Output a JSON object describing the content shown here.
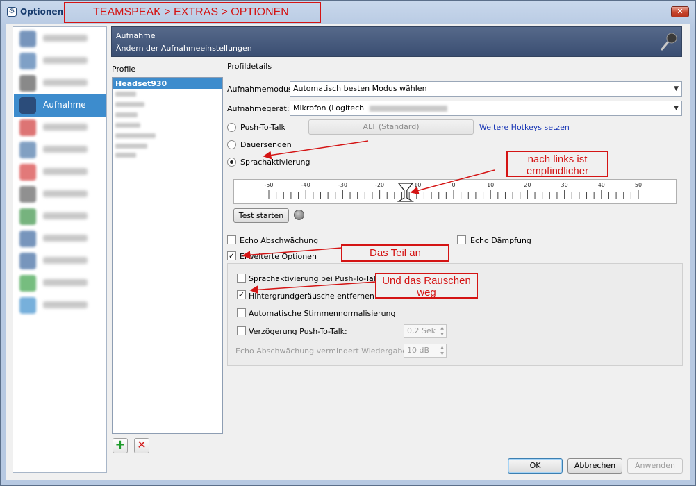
{
  "window": {
    "title": "Optionen",
    "close_symbol": "✕"
  },
  "annotation_title": "TEAMSPEAK > EXTRAS > OPTIONEN",
  "sidebar": {
    "active_label": "Aufnahme",
    "items": [
      {
        "icon": "blurred-icon",
        "color": "#2f5d99"
      },
      {
        "icon": "blurred-icon",
        "color": "#3c6ea8"
      },
      {
        "icon": "blurred-icon",
        "color": "#4b4b4b"
      },
      {
        "icon": "microphone-icon",
        "color": "#2b4c7a"
      },
      {
        "icon": "blurred-icon",
        "color": "#cc2a2a"
      },
      {
        "icon": "blurred-icon",
        "color": "#3f6ea3"
      },
      {
        "icon": "blurred-icon",
        "color": "#d43232"
      },
      {
        "icon": "blurred-icon",
        "color": "#555555"
      },
      {
        "icon": "blurred-icon",
        "color": "#2e8c3a"
      },
      {
        "icon": "blurred-icon",
        "color": "#2f5d99"
      },
      {
        "icon": "blurred-icon",
        "color": "#2f5d99"
      },
      {
        "icon": "blurred-icon",
        "color": "#2e9a3c"
      },
      {
        "icon": "blurred-icon",
        "color": "#2f86c8"
      }
    ]
  },
  "banner": {
    "title": "Aufnahme",
    "subtitle": "Ändern der Aufnahmeeinstellungen"
  },
  "profiles": {
    "heading": "Profile",
    "selected": "Headset930",
    "add_symbol": "+",
    "remove_symbol": "✕"
  },
  "details": {
    "heading": "Profildetails",
    "mode_label": "Aufnahmemodus:",
    "mode_value": "Automatisch besten Modus wählen",
    "device_label": "Aufnahmegerät:",
    "device_value": "Mikrofon (Logitech",
    "combo_arrow": "▼",
    "ptt_label": "Push-To-Talk",
    "hotkey_button": "ALT (Standard)",
    "hotkeys_link": "Weitere Hotkeys setzen",
    "continuous_label": "Dauersenden",
    "voice_activation_label": "Sprachaktivierung",
    "slider_ticks": [
      "-50",
      "-40",
      "-30",
      "-20",
      "-10",
      "0",
      "10",
      "20",
      "30",
      "40",
      "50"
    ],
    "slider_value": -13,
    "test_button": "Test starten",
    "echo_reduction_label": "Echo Abschwächung",
    "echo_cancel_label": "Echo Dämpfung",
    "advanced_label": "Erweiterte Optionen",
    "advanced": {
      "va_in_ptt_label": "Sprachaktivierung bei Push-To-Talk",
      "bg_noise_label": "Hintergrundgeräusche entfernen",
      "auto_norm_label": "Automatische Stimmennormalisierung",
      "ptt_delay_label": "Verzögerung Push-To-Talk:",
      "ptt_delay_value": "0,2 Sek",
      "echo_reduce_playback_label": "Echo Abschwächung vermindert Wiedergabe um:",
      "echo_reduce_playback_value": "10 dB"
    },
    "checkmark": "✓"
  },
  "notes": {
    "sensitivity": "nach links ist empfindlicher",
    "enable_advanced": "Das Teil an",
    "remove_noise": "Und das Rauschen weg"
  },
  "buttons": {
    "ok": "OK",
    "cancel": "Abbrechen",
    "apply": "Anwenden"
  },
  "colors": {
    "accent": "#3d8ccd",
    "annotation": "#d41414",
    "link": "#1533b4"
  }
}
